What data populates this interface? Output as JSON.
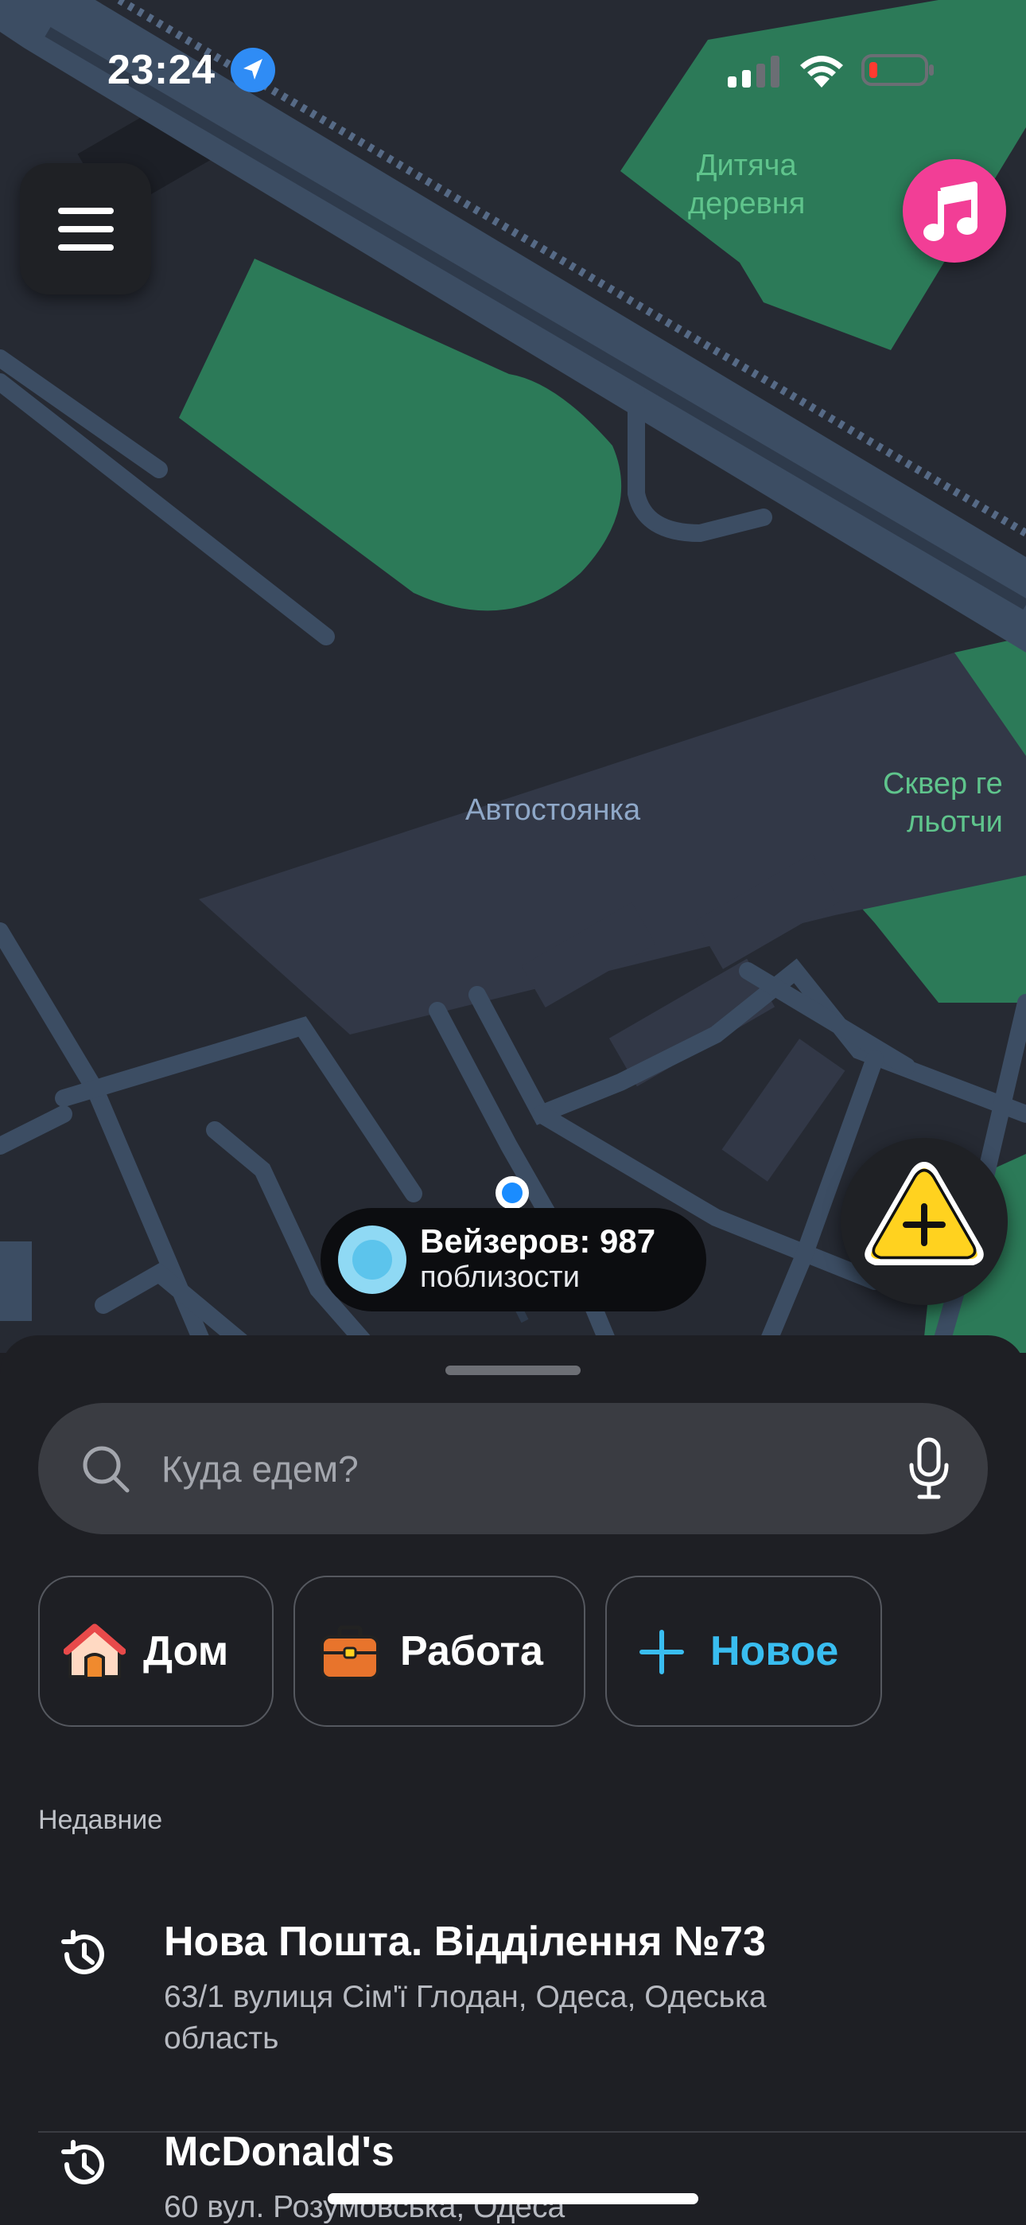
{
  "status_bar": {
    "time": "23:24",
    "icons": [
      "location-arrow-icon",
      "cellular-signal-icon",
      "wifi-icon",
      "battery-low-icon"
    ]
  },
  "map": {
    "labels": {
      "park_top": "Дитяча\nдеревня",
      "parking": "Автостоянка",
      "park_right": "Сквер ге\nльотчи"
    },
    "colors": {
      "background": "#262a33",
      "road": "#3c4d63",
      "park": "#2c7a58"
    }
  },
  "controls": {
    "menu_icon": "hamburger-menu-icon",
    "music_icon": "music-note-icon",
    "report_icon": "report-hazard-plus-icon"
  },
  "wazers": {
    "count_text": "Вейзеров: 987",
    "subtitle": "поблизости"
  },
  "search": {
    "placeholder": "Куда едем?",
    "value": ""
  },
  "shortcuts": [
    {
      "label": "Дом",
      "icon": "home-icon"
    },
    {
      "label": "Работа",
      "icon": "briefcase-icon"
    },
    {
      "label": "Новое",
      "icon": "plus-icon"
    }
  ],
  "recent": {
    "heading": "Недавние",
    "items": [
      {
        "title": "Нова Пошта. Відділення №73",
        "address": "63/1 вулиця Сім'ї Глодан, Одеса, Одеська область"
      },
      {
        "title": "McDonald's",
        "address": "60 вул. Розумовська, Одеса"
      }
    ]
  },
  "colors": {
    "accent": "#39bdf0",
    "music": "#f23e96",
    "report": "#ffd21f",
    "sheet": "#1e1f24",
    "search_field": "#3a3c42"
  }
}
